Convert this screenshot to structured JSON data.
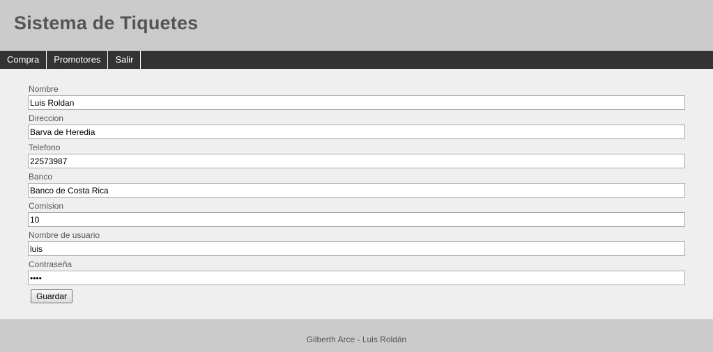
{
  "header": {
    "title": "Sistema de Tiquetes"
  },
  "nav": {
    "items": [
      {
        "label": "Compra"
      },
      {
        "label": "Promotores"
      },
      {
        "label": "Salir"
      }
    ]
  },
  "form": {
    "fields": [
      {
        "label": "Nombre",
        "value": "Luis Roldan"
      },
      {
        "label": "Direccion",
        "value": "Barva de Heredia"
      },
      {
        "label": "Telefono",
        "value": "22573987"
      },
      {
        "label": "Banco",
        "value": "Banco de Costa Rica"
      },
      {
        "label": "Comision",
        "value": "10"
      },
      {
        "label": "Nombre de usuario",
        "value": "luis"
      },
      {
        "label": "Contraseña",
        "value": "luis"
      }
    ],
    "save_label": "Guardar"
  },
  "footer": {
    "text": "Gilberth Arce - Luis Roldán"
  },
  "colors": {
    "header_bg": "#cbcbcb",
    "nav_bg": "#333333",
    "content_bg": "#efefef",
    "text": "#555555"
  }
}
